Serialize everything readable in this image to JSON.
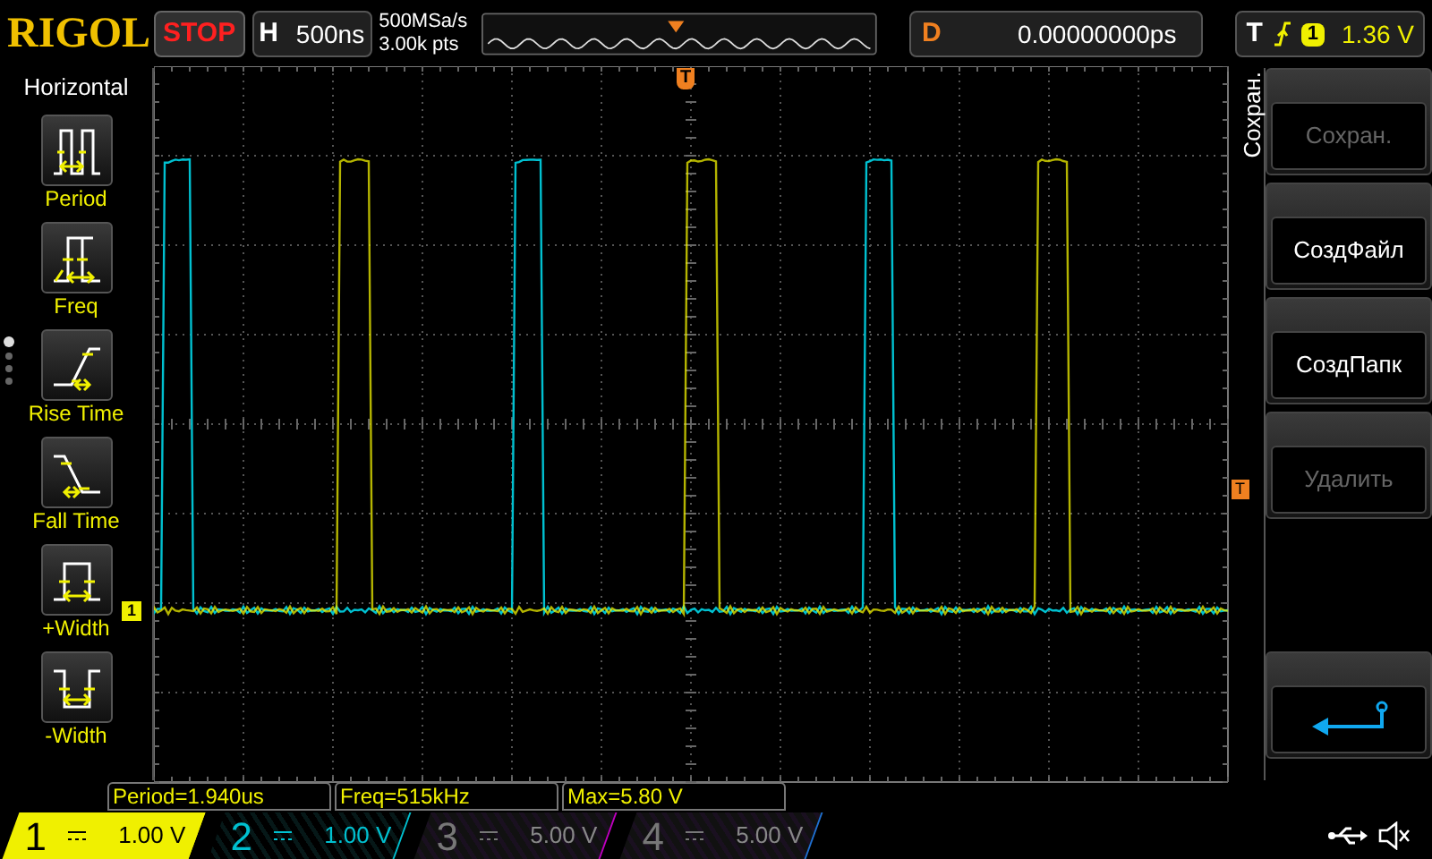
{
  "top_bar": {
    "logo": "RIGOL",
    "run_state": "STOP",
    "horizontal_label": "H",
    "timebase": "500ns",
    "sample_rate": "500MSa/s",
    "memory_depth": "3.00k pts",
    "delay_label": "D",
    "delay": "0.00000000ps",
    "trigger_label": "T",
    "trigger_source": "1",
    "trigger_level": "1.36 V"
  },
  "left_menu": {
    "title": "Horizontal",
    "items": [
      {
        "kind": "period",
        "label": "Period"
      },
      {
        "kind": "freq",
        "label": "Freq"
      },
      {
        "kind": "rise",
        "label": "Rise Time"
      },
      {
        "kind": "fall",
        "label": "Fall Time"
      },
      {
        "kind": "pwidth",
        "label": "+Width"
      },
      {
        "kind": "nwidth",
        "label": "-Width"
      }
    ],
    "page_dots": [
      {
        "selected": true
      },
      {
        "selected": false
      },
      {
        "selected": false
      },
      {
        "selected": false
      }
    ]
  },
  "screen": {
    "trigger_position_marker": "T",
    "trigger_level_marker": "T",
    "channel_marker": "1"
  },
  "right_menu": {
    "title": "Сохран.",
    "items": [
      {
        "kind": "text",
        "label": "Сохран.",
        "disabled": true
      },
      {
        "kind": "text",
        "label": "СоздФайл",
        "disabled": false
      },
      {
        "kind": "text",
        "label": "СоздПапк",
        "disabled": false
      },
      {
        "kind": "text",
        "label": "Удалить",
        "disabled": true
      },
      {
        "kind": "back"
      }
    ]
  },
  "measurements": [
    "Period=1.940us",
    "Freq=515kHz",
    "Max=5.80 V"
  ],
  "channels": [
    {
      "number": "1",
      "scale": "1.00 V",
      "color": "#f0f000",
      "selected": true,
      "enabled": true
    },
    {
      "number": "2",
      "scale": "1.00 V",
      "color": "#00c0d0",
      "selected": false,
      "enabled": true
    },
    {
      "number": "3",
      "scale": "5.00 V",
      "color": "#c000c0",
      "selected": false,
      "enabled": false
    },
    {
      "number": "4",
      "scale": "5.00 V",
      "color": "#2070d0",
      "selected": false,
      "enabled": false
    }
  ]
}
